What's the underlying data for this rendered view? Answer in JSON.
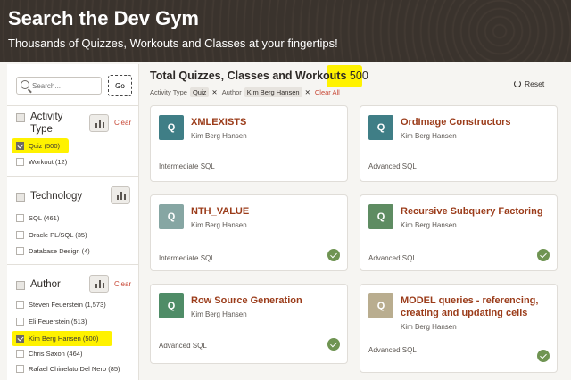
{
  "banner": {
    "title": "Search the Dev Gym",
    "subtitle": "Thousands of Quizzes, Workouts and Classes at your fingertips!"
  },
  "search": {
    "placeholder": "Search...",
    "go_label": "Go"
  },
  "facets": {
    "activity_type": {
      "title": "Activity Type",
      "clear_label": "Clear",
      "options": [
        {
          "label": "Quiz (500)",
          "checked": true
        },
        {
          "label": "Workout (12)",
          "checked": false
        }
      ]
    },
    "technology": {
      "title": "Technology",
      "options": [
        {
          "label": "SQL (461)",
          "checked": false
        },
        {
          "label": "Oracle PL/SQL (35)",
          "checked": false
        },
        {
          "label": "Database Design (4)",
          "checked": false
        }
      ]
    },
    "author": {
      "title": "Author",
      "clear_label": "Clear",
      "options": [
        {
          "label": "Steven Feuerstein (1,573)",
          "checked": false
        },
        {
          "label": "Eli Feuerstein (513)",
          "checked": false
        },
        {
          "label": "Kim Berg Hansen (500)",
          "checked": true
        },
        {
          "label": "Chris Saxon (464)",
          "checked": false
        },
        {
          "label": "Rafael Chinelato Del Nero (85)",
          "checked": false
        }
      ]
    }
  },
  "results": {
    "heading": "Total Quizzes, Classes and Workouts",
    "count": "500",
    "reset_label": "Reset",
    "filters": {
      "type_label": "Activity Type",
      "type_value": "Quiz",
      "author_label": "Author",
      "author_value": "Kim Berg Hansen",
      "remove_glyph": "✕",
      "clear_all": "Clear All"
    },
    "cards": [
      {
        "badge": "Q",
        "title": "XMLEXISTS",
        "author": "Kim Berg Hansen",
        "level": "Intermediate SQL",
        "completed": false,
        "thumb_color": "#3f7e86"
      },
      {
        "badge": "Q",
        "title": "OrdImage Constructors",
        "author": "Kim Berg Hansen",
        "level": "Advanced SQL",
        "completed": false,
        "thumb_color": "#3f7e86"
      },
      {
        "badge": "Q",
        "title": "NTH_VALUE",
        "author": "Kim Berg Hansen",
        "level": "Intermediate SQL",
        "completed": true,
        "thumb_color": "#86a6a3"
      },
      {
        "badge": "Q",
        "title": "Recursive Subquery Factoring",
        "author": "Kim Berg Hansen",
        "level": "Advanced SQL",
        "completed": true,
        "thumb_color": "#5e8c62"
      },
      {
        "badge": "Q",
        "title": "Row Source Generation",
        "author": "Kim Berg Hansen",
        "level": "Advanced SQL",
        "completed": true,
        "thumb_color": "#4f8c67"
      },
      {
        "badge": "Q",
        "title": "MODEL queries - referencing, creating and updating cells",
        "author": "Kim Berg Hansen",
        "level": "Advanced SQL",
        "completed": true,
        "thumb_color": "#b9ad8f"
      }
    ]
  },
  "colors": {
    "accent": "#c74634",
    "title_link": "#9b3c1a",
    "highlight": "#fff200",
    "check": "#6f9452"
  }
}
